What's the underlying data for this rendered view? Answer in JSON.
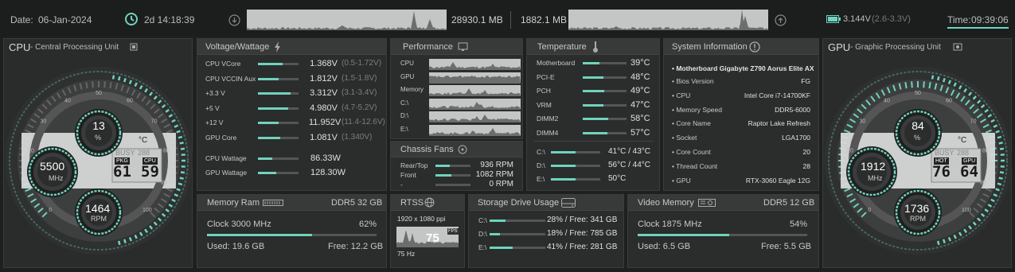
{
  "colors": {
    "accent": "#6fd3bd",
    "panel": "#2b2c2c",
    "background": "#1e1f1f"
  },
  "top": {
    "date_label": "Date:",
    "date": "06-Jan-2024",
    "uptime": "2d 14:18:39",
    "uptime_icon": "clock-icon",
    "download_icon": "download-arrow-icon",
    "upload_icon": "upload-arrow-icon",
    "down_value": "28930.1 MB",
    "up_value": "1882.1 MB",
    "battery_icon": "battery-icon",
    "voltage": "3.144V",
    "voltage_range": "(2.6-3.3V)",
    "time_label": "Time:",
    "time": "09:39:06"
  },
  "cpu": {
    "title": "CPU",
    "subtitle": "- Central Processing Unit",
    "icon": "chip-icon",
    "load": "13",
    "load_unit": "%",
    "clock": "5500",
    "clock_unit": "MHz",
    "rpm": "1464",
    "rpm_unit": "RPM",
    "temp_unit": "°C",
    "pkg_label": "PKG",
    "cpu_label": "CPU",
    "pkg_temp": "61",
    "cpu_temp": "59",
    "busy_label": "BUSY",
    "busy_value": "288",
    "dial_ticks": [
      "0",
      "10",
      "20",
      "30",
      "40",
      "50",
      "60",
      "70",
      "80",
      "90",
      "100"
    ],
    "dial_level": 0.13
  },
  "gpu": {
    "title": "GPU",
    "subtitle": "- Graphic Processing Unit",
    "icon": "gpu-card-icon",
    "load": "84",
    "load_unit": "%",
    "clock": "1912",
    "clock_unit": "MHz",
    "rpm": "1736",
    "rpm_unit": "RPM",
    "temp_unit": "°C",
    "hot_label": "HOT",
    "gpu_label": "GPU",
    "hot_temp": "76",
    "gpu_temp": "64",
    "busy_label": "BUSY",
    "busy_value": "288",
    "dial_ticks": [
      "0",
      "10",
      "20",
      "30",
      "40",
      "50",
      "60",
      "70",
      "80",
      "90",
      "100"
    ],
    "dial_level": 0.84
  },
  "voltage": {
    "title": "Voltage/Wattage",
    "icon": "lightning-icon",
    "rows": [
      {
        "label": "CPU VCore",
        "value": "1.368V",
        "range": "(0.5-1.72V)",
        "level": 0.6
      },
      {
        "label": "CPU VCCIN Aux",
        "value": "1.812V",
        "range": "(1.5-1.8V)",
        "level": 0.5
      },
      {
        "label": "+3.3 V",
        "value": "3.312V",
        "range": "(3.1-3.4V)",
        "level": 0.8
      },
      {
        "label": "+5 V",
        "value": "4.980V",
        "range": "(4.7-5.2V)",
        "level": 0.75
      },
      {
        "label": "+12 V",
        "value": "11.952V",
        "range": "(11.4-12.6V)",
        "level": 0.5
      },
      {
        "label": "GPU Core",
        "value": "1.081V",
        "range": "(1.340V)",
        "level": 0.55
      }
    ],
    "watt_rows": [
      {
        "label": "CPU Wattage",
        "value": "86.33W",
        "level": 0.35
      },
      {
        "label": "GPU Wattage",
        "value": "128.30W",
        "level": 0.45
      }
    ]
  },
  "performance": {
    "title": "Performance",
    "icon": "monitor-icon",
    "rows": [
      "CPU",
      "GPU",
      "Memory",
      "C:\\",
      "D:\\",
      "E:\\"
    ]
  },
  "fans": {
    "title": "Chassis Fans",
    "icon": "fan-icon",
    "rows": [
      {
        "label": "Rear/Top",
        "value": "936 RPM",
        "level": 0.4
      },
      {
        "label": "Front",
        "value": "1082 RPM",
        "level": 0.45
      },
      {
        "label": "-",
        "value": "0 RPM",
        "level": 0.0
      }
    ]
  },
  "temperature": {
    "title": "Temperature",
    "icon": "thermometer-icon",
    "rows": [
      {
        "label": "Motherboard",
        "value": "39°C",
        "level": 0.39
      },
      {
        "label": "PCI-E",
        "value": "48°C",
        "level": 0.48
      },
      {
        "label": "PCH",
        "value": "49°C",
        "level": 0.49
      },
      {
        "label": "VRM",
        "value": "47°C",
        "level": 0.47
      },
      {
        "label": "DIMM2",
        "value": "58°C",
        "level": 0.58
      },
      {
        "label": "DIMM4",
        "value": "57°C",
        "level": 0.57
      }
    ],
    "drive_rows": [
      {
        "label": "C:\\",
        "value": "41°C / 43°C"
      },
      {
        "label": "D:\\",
        "value": "56°C / 44°C"
      },
      {
        "label": "E:\\",
        "value": "50°C"
      }
    ]
  },
  "sysinfo": {
    "title": "System Information",
    "icon": "info-icon",
    "motherboard": "• Motherboard Gigabyte Z790 Aorus Elite AX",
    "rows": [
      {
        "label": "• Bios Version",
        "value": "FG"
      },
      {
        "label": "• CPU",
        "value": "Intel Core i7-14700KF"
      },
      {
        "label": "• Memory Speed",
        "value": "DDR5-6000"
      },
      {
        "label": "• Core Name",
        "value": "Raptor Lake Refresh"
      },
      {
        "label": "• Socket",
        "value": "LGA1700"
      },
      {
        "label": "• Core Count",
        "value": "20"
      },
      {
        "label": "• Thread Count",
        "value": "28"
      },
      {
        "label": "• GPU",
        "value": "RTX-3060 Eagle 12G"
      }
    ]
  },
  "memory": {
    "title": "Memory Ram",
    "icon": "ram-icon",
    "type": "DDR5 32 GB",
    "clock": "Clock 3000 MHz",
    "percent": "62%",
    "level": 0.62,
    "used": "Used: 19.6 GB",
    "free": "Free: 12.2 GB"
  },
  "rtss": {
    "title": "RTSS",
    "icon": "globe-icon",
    "resolution": "1920 x 1080 ppi",
    "fps": "75",
    "fps_label": "FPS",
    "hz": "75 Hz"
  },
  "storage": {
    "title": "Storage Drive Usage",
    "icon": "drive-icon",
    "rows": [
      {
        "label": "C:\\",
        "value": "28% / Free: 341 GB",
        "level": 0.28
      },
      {
        "label": "D:\\",
        "value": "18% / Free: 785 GB",
        "level": 0.18
      },
      {
        "label": "E:\\",
        "value": "41% / Free: 281 GB",
        "level": 0.41
      }
    ]
  },
  "video": {
    "title": "Video Memory",
    "icon": "video-card-icon",
    "type": "DDR5 12 GB",
    "clock": "Clock 1875 MHz",
    "percent": "54%",
    "level": 0.54,
    "used": "Used: 6.5 GB",
    "free": "Free: 5.5 GB"
  }
}
